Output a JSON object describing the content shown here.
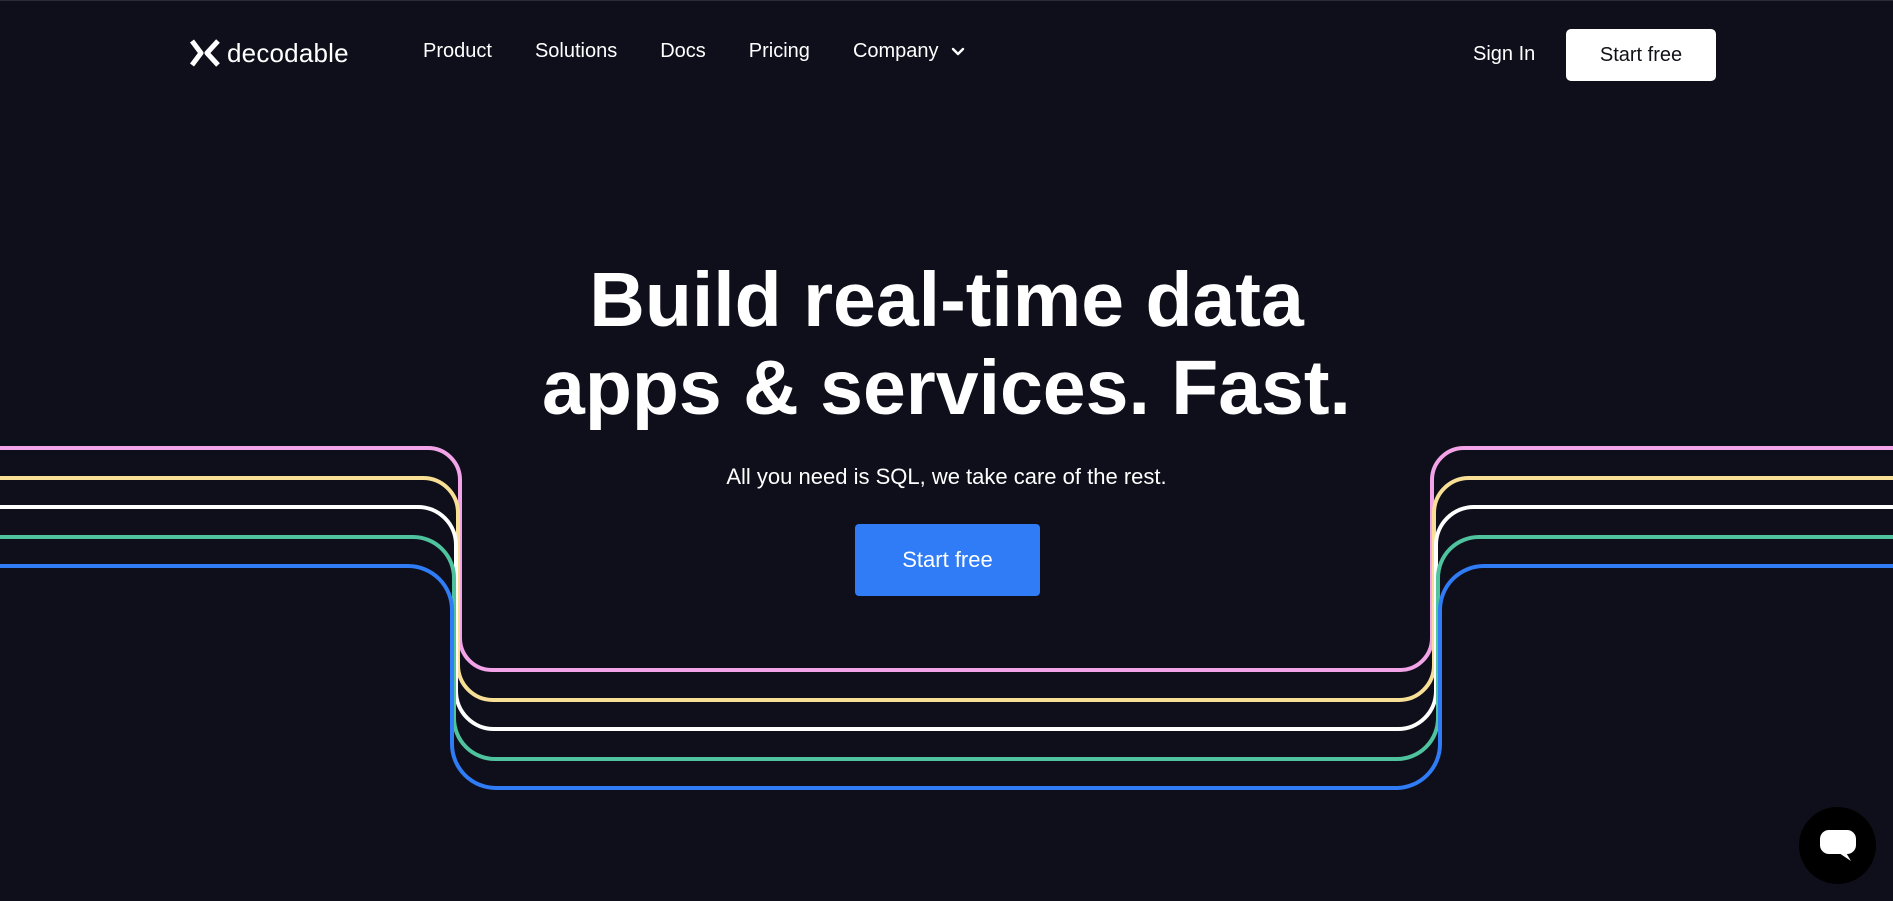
{
  "brand": {
    "name": "decodable",
    "logo_icon": "decodable-logo-icon"
  },
  "nav": {
    "items": [
      {
        "label": "Product"
      },
      {
        "label": "Solutions"
      },
      {
        "label": "Docs"
      },
      {
        "label": "Pricing"
      },
      {
        "label": "Company",
        "has_dropdown": true
      }
    ],
    "sign_in": "Sign In",
    "start_free": "Start free"
  },
  "hero": {
    "title_line1": "Build real-time data",
    "title_line2": "apps & services. Fast.",
    "subtitle": "All you need is SQL, we take care of the rest.",
    "cta_label": "Start free"
  },
  "decoration": {
    "line_colors": [
      "#f3a3e8",
      "#f7df96",
      "#ffffff",
      "#4fc39d",
      "#2f7cf6"
    ]
  },
  "chat": {
    "icon": "chat-bubble-icon"
  },
  "colors": {
    "background": "#0e0f1a",
    "accent": "#2f7cf6"
  }
}
